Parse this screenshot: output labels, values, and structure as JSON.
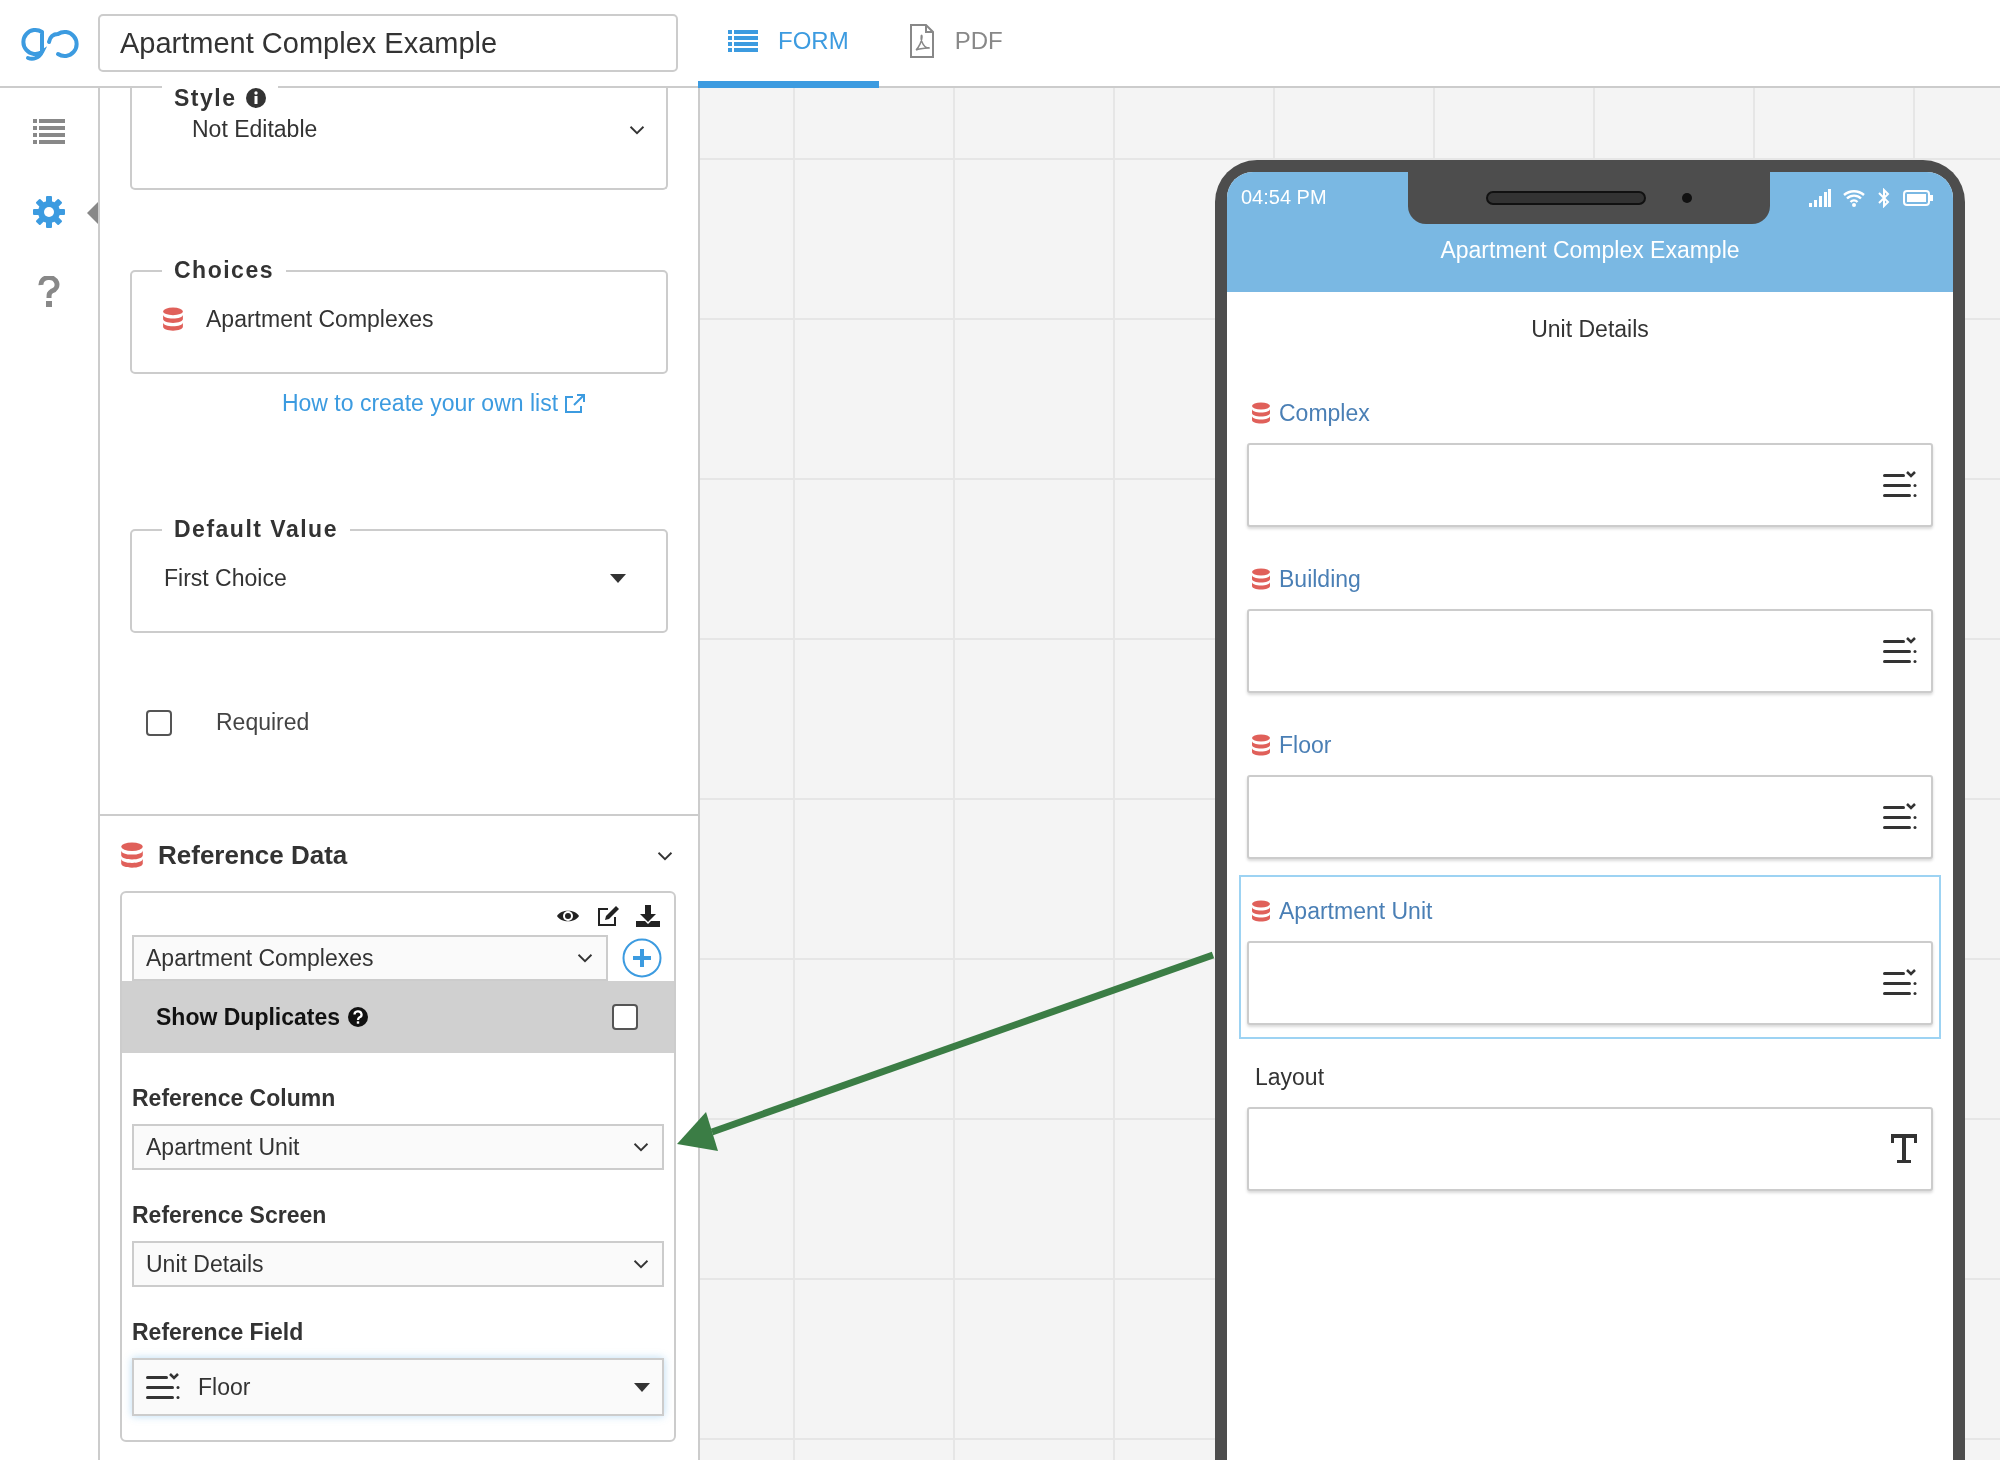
{
  "app": {
    "title": "Apartment Complex Example"
  },
  "tabs": [
    {
      "label": "FORM",
      "kind": "form",
      "selected": true
    },
    {
      "label": "PDF",
      "kind": "pdf",
      "selected": false
    }
  ],
  "rail": [
    {
      "kind": "list",
      "selected": false
    },
    {
      "kind": "settings",
      "selected": true
    },
    {
      "kind": "help",
      "selected": false
    }
  ],
  "properties": {
    "style": {
      "legend": "Style",
      "value": "Not Editable"
    },
    "choices": {
      "legend": "Choices",
      "value": "Apartment Complexes"
    },
    "help_link": "How to create your own list",
    "default_value": {
      "legend": "Default Value",
      "value": "First Choice"
    },
    "required": {
      "label": "Required",
      "checked": false
    }
  },
  "reference_data": {
    "title": "Reference Data",
    "source": "Apartment Complexes",
    "show_duplicates": {
      "label": "Show Duplicates",
      "checked": false
    },
    "fields": [
      {
        "label": "Reference Column",
        "value": "Apartment Unit",
        "kind": "plain"
      },
      {
        "label": "Reference Screen",
        "value": "Unit Details",
        "kind": "plain"
      },
      {
        "label": "Reference Field",
        "value": "Floor",
        "kind": "field"
      }
    ]
  },
  "phone": {
    "time": "04:54 PM",
    "title": "Apartment Complex Example",
    "screen": "Unit Details",
    "fields": [
      {
        "label": "Complex",
        "kind": "choice",
        "selected": false
      },
      {
        "label": "Building",
        "kind": "choice",
        "selected": false
      },
      {
        "label": "Floor",
        "kind": "choice",
        "selected": false
      },
      {
        "label": "Apartment Unit",
        "kind": "choice",
        "selected": true
      },
      {
        "label": "Layout",
        "kind": "text",
        "selected": false
      }
    ]
  }
}
